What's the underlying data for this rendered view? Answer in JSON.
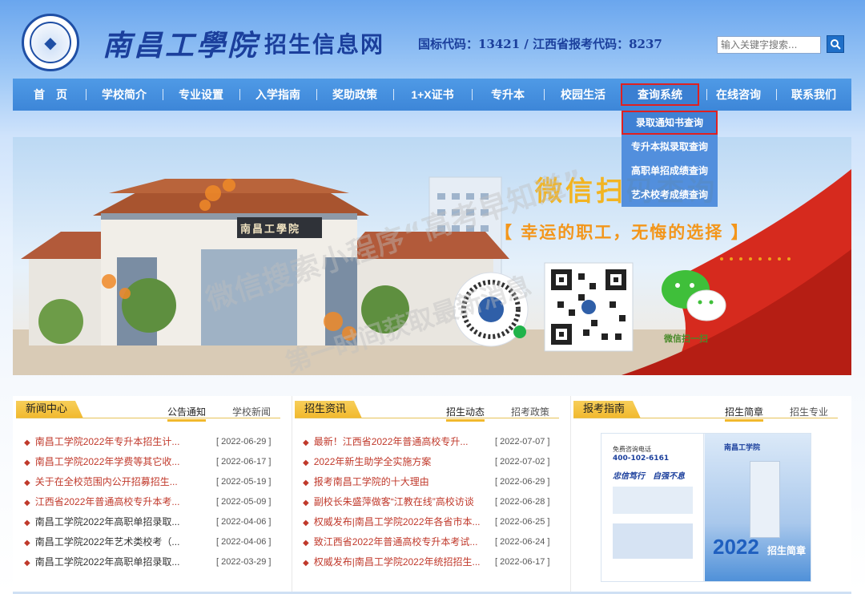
{
  "header": {
    "school_name": "南昌工學院",
    "site_name": "招生信息网",
    "codes": "国标代码：13421 / 江西省报考代码：8237",
    "search_placeholder": "输入关键字搜索..."
  },
  "nav": {
    "items": [
      {
        "label": "首　页"
      },
      {
        "label": "学校简介"
      },
      {
        "label": "专业设置"
      },
      {
        "label": "入学指南"
      },
      {
        "label": "奖助政策"
      },
      {
        "label": "1+X证书"
      },
      {
        "label": "专升本"
      },
      {
        "label": "校园生活"
      },
      {
        "label": "查询系统"
      },
      {
        "label": "在线咨询"
      },
      {
        "label": "联系我们"
      }
    ],
    "dropdown": [
      {
        "label": "录取通知书查询"
      },
      {
        "label": "专升本拟录取查询"
      },
      {
        "label": "高职单招成绩查询"
      },
      {
        "label": "艺术校考成绩查询"
      }
    ]
  },
  "banner": {
    "gate_sign": "南昌工學院",
    "slogan_1": "微信扫码查询",
    "slogan_2": "【 幸运的职工，无悔的选择 】",
    "qr_label": "微信扫一扫"
  },
  "watermark": {
    "line_1": "微信搜索小程序“高考早知道”",
    "line_2": "第一时间获取最新消息"
  },
  "news": {
    "title": "新闻中心",
    "tabs": [
      "公告通知",
      "学校新闻"
    ],
    "items": [
      {
        "text": "南昌工学院2022年专升本招生计...",
        "date": "[ 2022-06-29 ]",
        "color": "#c0392b"
      },
      {
        "text": "南昌工学院2022年学费等其它收...",
        "date": "[ 2022-06-17 ]",
        "color": "#c0392b"
      },
      {
        "text": "关于在全校范围内公开招募招生...",
        "date": "[ 2022-05-19 ]",
        "color": "#c0392b"
      },
      {
        "text": "江西省2022年普通高校专升本考...",
        "date": "[ 2022-05-09 ]",
        "color": "#c0392b"
      },
      {
        "text": "南昌工学院2022年高职单招录取...",
        "date": "[ 2022-04-06 ]",
        "color": "#333333"
      },
      {
        "text": "南昌工学院2022年艺术类校考（...",
        "date": "[ 2022-04-06 ]",
        "color": "#333333"
      },
      {
        "text": "南昌工学院2022年高职单招录取...",
        "date": "[ 2022-03-29 ]",
        "color": "#333333"
      }
    ]
  },
  "admissions": {
    "title": "招生资讯",
    "tabs": [
      "招生动态",
      "招考政策"
    ],
    "items": [
      {
        "text": "最新！江西省2022年普通高校专升...",
        "date": "[ 2022-07-07 ]"
      },
      {
        "text": "2022年新生助学全实施方案",
        "date": "[ 2022-07-02 ]"
      },
      {
        "text": "报考南昌工学院的十大理由",
        "date": "[ 2022-06-29 ]"
      },
      {
        "text": "副校长朱盛萍做客“江教在线”高校访谈",
        "date": "[ 2022-06-28 ]"
      },
      {
        "text": "权威发布|南昌工学院2022年各省市本...",
        "date": "[ 2022-06-25 ]"
      },
      {
        "text": "致江西省2022年普通高校专升本考试...",
        "date": "[ 2022-06-24 ]"
      },
      {
        "text": "权威发布|南昌工学院2022年统招招生...",
        "date": "[ 2022-06-17 ]"
      }
    ]
  },
  "guide": {
    "title": "报考指南",
    "tabs": [
      "招生简章",
      "招生专业"
    ],
    "brochure": {
      "phone_label": "免费咨询电话",
      "phone": "400-102-6161",
      "motto": "忠信笃行　自强不息",
      "school": "南昌工学院",
      "year": "2022",
      "caption": "招生简章"
    }
  },
  "colors": {
    "nav": "#3d86d8",
    "accent_red": "#e02020",
    "tab_gold": "#f1b82c",
    "brand_blue": "#1b3f9c"
  }
}
